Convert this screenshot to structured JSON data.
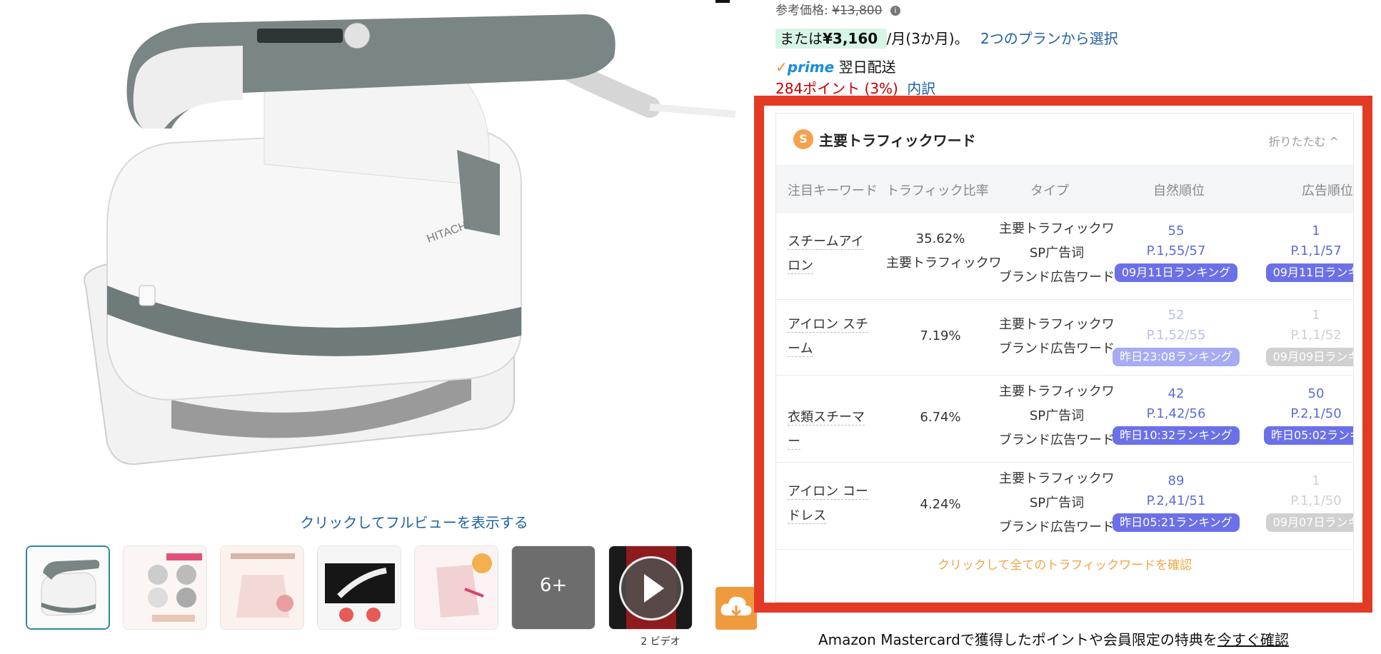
{
  "product": {
    "brand_text": "HITACHI",
    "fullview_link": "クリックしてフルビューを表示する",
    "thumbnails": [
      "thumb-1",
      "thumb-2",
      "thumb-3",
      "thumb-4",
      "thumb-5"
    ],
    "more_label": "6+",
    "video_caption": "2 ビデオ"
  },
  "price": {
    "ref_label": "参考価格:",
    "ref_value": "¥13,800",
    "installment_prefix": "または",
    "installment_amount": "¥3,160",
    "installment_suffix": "/月(3か月)。",
    "plan_link": "2つのプランから選択",
    "prime_logo": "prime",
    "delivery": "翌日配送",
    "points": "284ポイント (3%)",
    "points_link": "内訳"
  },
  "traffic": {
    "logo": "S",
    "title": "主要トラフィックワード",
    "collapse": "折りたたむ ^",
    "headers": {
      "keyword": "注目キーワード",
      "ratio": "トラフィック比率",
      "type": "タイプ",
      "organic": "自然順位",
      "ad": "広告順位"
    },
    "rows": [
      {
        "keyword": "スチームアイロン",
        "ratio": "35.62%",
        "ratio_sub": "主要トラフィックワ",
        "types": [
          "主要トラフィックワ",
          "SP广告词",
          "ブランド広告ワード"
        ],
        "organic_rank": "55",
        "organic_page": "P.1,55/57",
        "organic_badge": "09月11日ランキング",
        "ad_rank": "1",
        "ad_page": "P.1,1/57",
        "ad_badge": "09月11日ランキ"
      },
      {
        "keyword": "アイロン スチーム",
        "ratio": "7.19%",
        "types": [
          "主要トラフィックワ",
          "ブランド広告ワード"
        ],
        "organic_rank": "52",
        "organic_page": "P.1,52/55",
        "organic_badge": "昨日23:08ランキング",
        "ad_rank": "1",
        "ad_page": "P.1,1/52",
        "ad_badge": "09月09日ランキ"
      },
      {
        "keyword": "衣類スチーマー",
        "ratio": "6.74%",
        "types": [
          "主要トラフィックワ",
          "SP广告词",
          "ブランド広告ワード"
        ],
        "organic_rank": "42",
        "organic_page": "P.1,42/56",
        "organic_badge": "昨日10:32ランキング",
        "ad_rank": "50",
        "ad_page": "P.2,1/50",
        "ad_badge": "昨日05:02ランキ"
      },
      {
        "keyword": "アイロン コードレス",
        "ratio": "4.24%",
        "types": [
          "主要トラフィックワ",
          "SP广告词",
          "ブランド広告ワード"
        ],
        "organic_rank": "89",
        "organic_page": "P.2,41/51",
        "organic_badge": "昨日05:21ランキング",
        "ad_rank": "1",
        "ad_page": "P.1,1/50",
        "ad_badge": "09月07日ランキ"
      }
    ],
    "more_link": "クリックして全てのトラフィックワードを確認"
  },
  "mastercard": {
    "text": "Amazon Mastercardで獲得したポイントや会員限定の特典を",
    "link": "今すぐ確認"
  },
  "colors": {
    "highlight": "#e33a26",
    "link": "#2162a1",
    "rank_blue": "#6b70e8",
    "orange": "#f2a545"
  }
}
